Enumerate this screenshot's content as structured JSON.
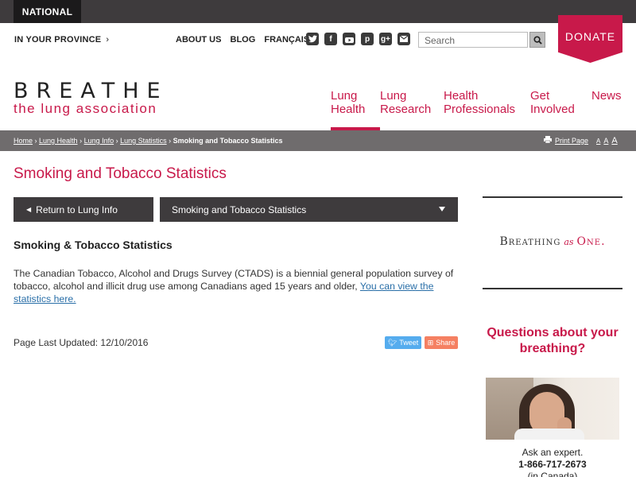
{
  "topbar": {
    "national_label": "NATIONAL"
  },
  "header": {
    "province_label": "IN YOUR PROVINCE",
    "links": [
      "ABOUT US",
      "BLOG",
      "FRANÇAIS"
    ],
    "social_icons": [
      "twitter-icon",
      "facebook-icon",
      "youtube-icon",
      "pinterest-icon",
      "google-plus-icon",
      "email-icon"
    ],
    "search_placeholder": "Search",
    "donate_label": "DONATE",
    "logo_main": "BREATHE",
    "logo_sub": "the lung association",
    "accent_color": "#c8194a",
    "nav": [
      {
        "line1": "Lung",
        "line2": "Health",
        "active": true
      },
      {
        "line1": "Lung",
        "line2": "Research",
        "active": false
      },
      {
        "line1": "Health",
        "line2": "Professionals",
        "active": false
      },
      {
        "line1": "Get",
        "line2": "Involved",
        "active": false
      },
      {
        "line1": "News",
        "line2": "",
        "active": false
      }
    ]
  },
  "breadcrumb": {
    "items": [
      "Home",
      "Lung Health",
      "Lung Info",
      "Lung Statistics"
    ],
    "current": "Smoking and Tobacco Statistics",
    "print_label": "Print Page",
    "font_sizes": [
      "A",
      "A",
      "A"
    ]
  },
  "main": {
    "title": "Smoking and Tobacco Statistics",
    "return_label": "Return to Lung Info",
    "dropdown_value": "Smoking and Tobacco Statistics",
    "section_heading": "Smoking & Tobacco Statistics",
    "body_text": "The Canadian Tobacco, Alcohol and Drugs Survey (CTADS) is a biennial general population survey of tobacco, alcohol and illicit drug use among Canadians aged 15 years and older, ",
    "body_link": "You can view the statistics here.",
    "updated_label": "Page Last Updated: 12/10/2016",
    "tweet_label": "Tweet",
    "share_label": "Share"
  },
  "sidebar": {
    "tagline_part1": "Breathing",
    "tagline_as": "as",
    "tagline_part2": "One.",
    "question": "Questions about your breathing?",
    "ask_label": "Ask an expert.",
    "phone": "1-866-717-2673",
    "phone_note": "(in Canada)"
  }
}
